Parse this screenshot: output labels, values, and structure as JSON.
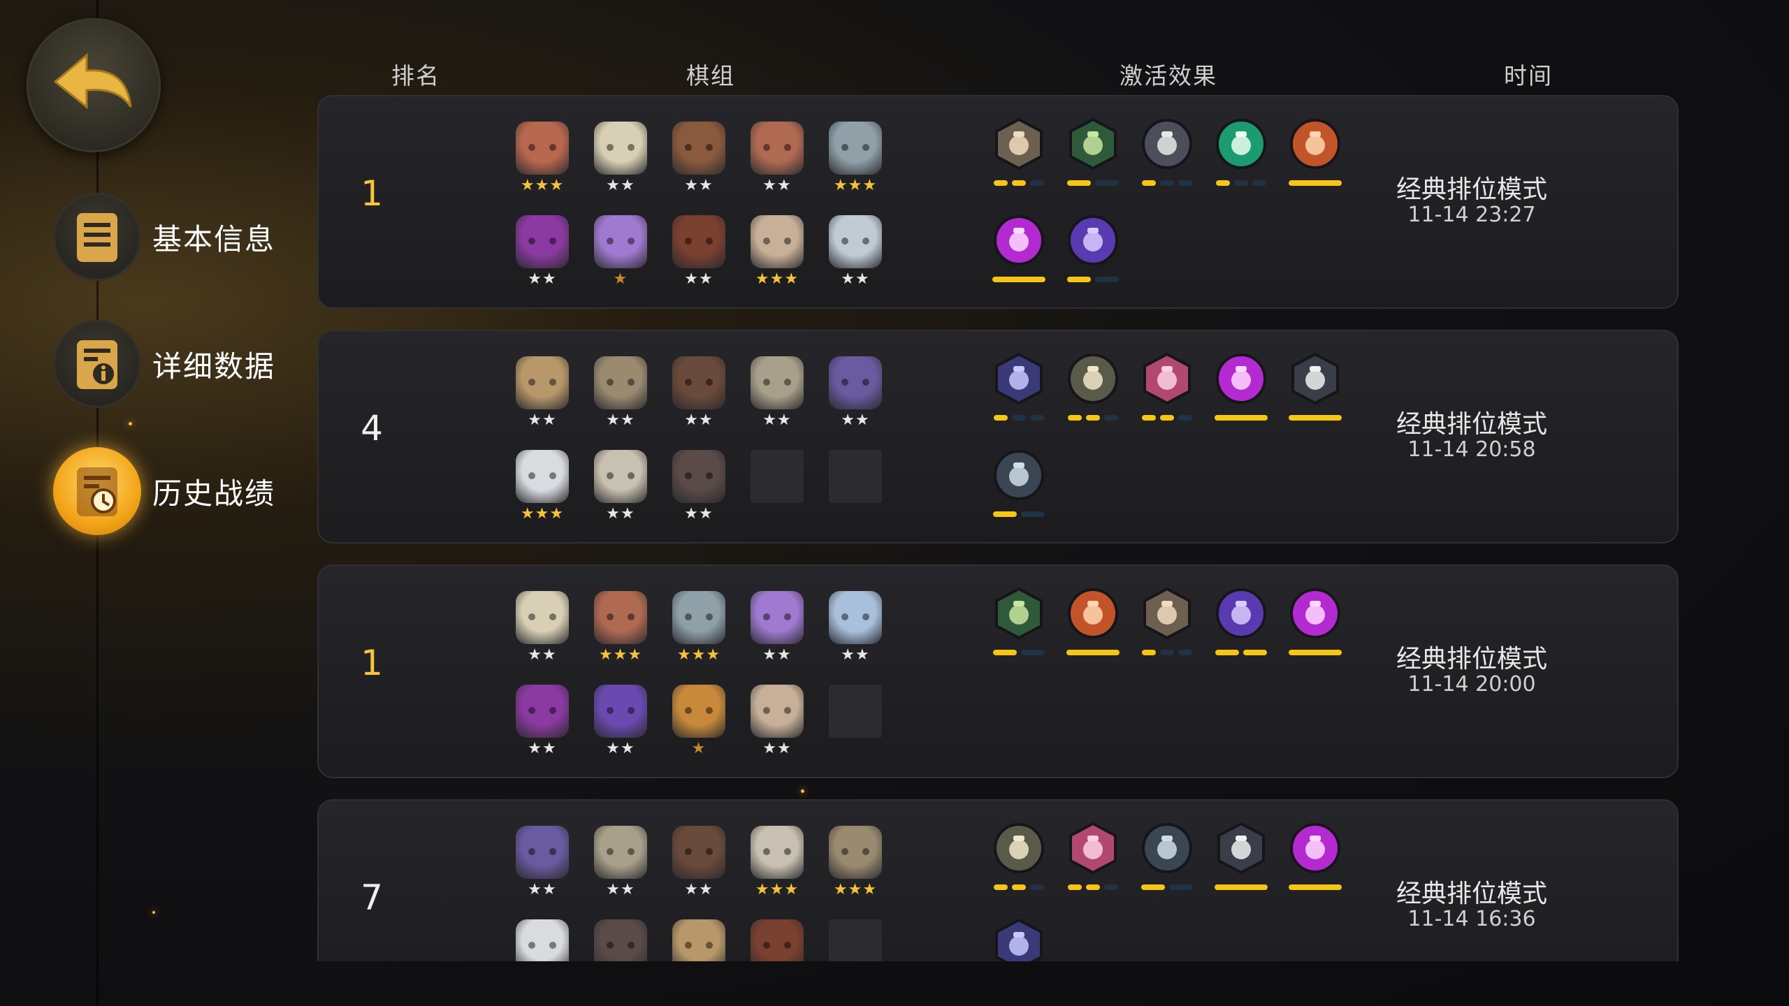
{
  "sidebar": {
    "back_icon": "back-arrow-icon",
    "items": [
      {
        "label": "基本信息",
        "icon": "document-icon",
        "active": false
      },
      {
        "label": "详细数据",
        "icon": "info-document-icon",
        "active": false
      },
      {
        "label": "历史战绩",
        "icon": "history-clock-icon",
        "active": true
      }
    ]
  },
  "table": {
    "headers": {
      "rank": "排名",
      "lineup": "棋组",
      "synergy": "激活效果",
      "time": "时间"
    },
    "rows": [
      {
        "rank": "1",
        "rank_color": "gold",
        "mode": "经典排位模式",
        "time": "11-14 23:27",
        "heroes": [
          {
            "icon": "owl-mask-hero-icon",
            "color": "#b8684e",
            "stars": "★★★",
            "tier": 3
          },
          {
            "icon": "white-hood-hero-icon",
            "color": "#d8cfb4",
            "stars": "★★",
            "tier": 2
          },
          {
            "icon": "boar-hero-icon",
            "color": "#8a5a3c",
            "stars": "★★",
            "tier": 2
          },
          {
            "icon": "goggles-dwarf-hero-icon",
            "color": "#b06a52",
            "stars": "★★",
            "tier": 2
          },
          {
            "icon": "ogre-hero-icon",
            "color": "#8fa0a8",
            "stars": "★★★",
            "tier": 3
          },
          {
            "icon": "horned-demon-hero-icon",
            "color": "#8a3aa0",
            "stars": "★★",
            "tier": 2
          },
          {
            "icon": "purple-hood-hero-icon",
            "color": "#a07ad0",
            "stars": "★",
            "tier": 1
          },
          {
            "icon": "red-cap-dwarf-hero-icon",
            "color": "#7a4030",
            "stars": "★★",
            "tier": 2
          },
          {
            "icon": "troll-hero-icon",
            "color": "#c8b098",
            "stars": "★★★",
            "tier": 3
          },
          {
            "icon": "white-haired-hero-icon",
            "color": "#c0ccd4",
            "stars": "★★",
            "tier": 2
          }
        ],
        "traits": [
          {
            "icon": "axe-warrior-trait-icon",
            "bg": "#6e6050",
            "fg": "#f2dcc0",
            "shape": "hex",
            "bar": [
              1,
              1,
              0
            ]
          },
          {
            "icon": "bow-hunter-trait-icon",
            "bg": "#2f5a3a",
            "fg": "#c8e6a0",
            "shape": "hex",
            "bar": [
              1,
              0
            ]
          },
          {
            "icon": "knight-helm-trait-icon",
            "bg": "#4a4f5a",
            "fg": "#e8e8e8",
            "shape": "circle",
            "bar": [
              1,
              0,
              0
            ]
          },
          {
            "icon": "beast-paw-trait-icon",
            "bg": "#1c9a70",
            "fg": "#e8fff0",
            "shape": "circle",
            "bar": [
              1,
              0,
              0
            ]
          },
          {
            "icon": "orc-trait-icon",
            "bg": "#c2542a",
            "fg": "#ffd6b0",
            "shape": "circle",
            "bar": [
              1
            ]
          },
          {
            "icon": "demon-trait-icon",
            "bg": "#b22ad0",
            "fg": "#ffd8ff",
            "shape": "circle",
            "bar": [
              1
            ]
          },
          {
            "icon": "fish-naga-trait-icon",
            "bg": "#5a3ab0",
            "fg": "#d8ccff",
            "shape": "circle",
            "bar": [
              1,
              0
            ]
          }
        ]
      },
      {
        "rank": "4",
        "rank_color": "white",
        "mode": "经典排位模式",
        "time": "11-14 20:58",
        "heroes": [
          {
            "icon": "tree-ent-hero-icon",
            "color": "#b8986a",
            "stars": "★★",
            "tier": 2
          },
          {
            "icon": "horned-orc-hero-icon",
            "color": "#9a8a70",
            "stars": "★★",
            "tier": 2
          },
          {
            "icon": "bull-hat-hero-icon",
            "color": "#6a4a3a",
            "stars": "★★",
            "tier": 2
          },
          {
            "icon": "stone-golem-hero-icon",
            "color": "#a8a08a",
            "stars": "★★",
            "tier": 2
          },
          {
            "icon": "bat-demon-hero-icon",
            "color": "#6a5aa0",
            "stars": "★★",
            "tier": 2
          },
          {
            "icon": "sheep-horn-hero-icon",
            "color": "#d8dce0",
            "stars": "★★★",
            "tier": 3
          },
          {
            "icon": "silver-hair-hero-icon",
            "color": "#c8c0b0",
            "stars": "★★",
            "tier": 2
          },
          {
            "icon": "dark-hair-hero-icon",
            "color": "#5a4a48",
            "stars": "★★",
            "tier": 2
          },
          {
            "empty": true
          },
          {
            "empty": true
          }
        ],
        "traits": [
          {
            "icon": "spellbook-trait-icon",
            "bg": "#3a3a78",
            "fg": "#c8c8ff",
            "shape": "hex",
            "bar": [
              1,
              0,
              0
            ]
          },
          {
            "icon": "goblin-trait-icon",
            "bg": "#5a5a4a",
            "fg": "#f0e8c8",
            "shape": "circle",
            "bar": [
              1,
              1,
              0
            ]
          },
          {
            "icon": "knight-chess-trait-icon",
            "bg": "#b04870",
            "fg": "#ffd0e0",
            "shape": "hex",
            "bar": [
              1,
              1,
              0
            ]
          },
          {
            "icon": "demon-trait-icon",
            "bg": "#b22ad0",
            "fg": "#ffd8ff",
            "shape": "circle",
            "bar": [
              1
            ]
          },
          {
            "icon": "cross-trait-icon",
            "bg": "#3a3e48",
            "fg": "#f0f0f0",
            "shape": "hex",
            "bar": [
              1
            ]
          },
          {
            "icon": "swirl-trait-icon",
            "bg": "#3a4654",
            "fg": "#d0dce8",
            "shape": "circle",
            "bar": [
              1,
              0
            ]
          }
        ]
      },
      {
        "rank": "1",
        "rank_color": "gold",
        "mode": "经典排位模式",
        "time": "11-14 20:00",
        "heroes": [
          {
            "icon": "white-hood-hero-icon",
            "color": "#d8cfb4",
            "stars": "★★",
            "tier": 2
          },
          {
            "icon": "goggles-dwarf-hero-icon",
            "color": "#b06a52",
            "stars": "★★★",
            "tier": 3
          },
          {
            "icon": "ogre-hero-icon",
            "color": "#8fa0a8",
            "stars": "★★★",
            "tier": 3
          },
          {
            "icon": "purple-hood-hero-icon",
            "color": "#a07ad0",
            "stars": "★★",
            "tier": 2
          },
          {
            "icon": "ghost-hero-icon",
            "color": "#a8c0dc",
            "stars": "★★",
            "tier": 2
          },
          {
            "icon": "horned-demon-hero-icon",
            "color": "#8a3aa0",
            "stars": "★★",
            "tier": 2
          },
          {
            "icon": "purple-mage-hero-icon",
            "color": "#6a4ab0",
            "stars": "★★",
            "tier": 2
          },
          {
            "icon": "witch-hat-hero-icon",
            "color": "#c88a3a",
            "stars": "★",
            "tier": 1
          },
          {
            "icon": "troll-hero-icon",
            "color": "#c8b098",
            "stars": "★★",
            "tier": 2
          },
          {
            "empty": true
          }
        ],
        "traits": [
          {
            "icon": "bow-hunter-trait-icon",
            "bg": "#2f5a3a",
            "fg": "#c8e6a0",
            "shape": "hex",
            "bar": [
              1,
              0
            ]
          },
          {
            "icon": "orc-trait-icon",
            "bg": "#c2542a",
            "fg": "#ffd6b0",
            "shape": "circle",
            "bar": [
              1
            ]
          },
          {
            "icon": "axe-warrior-trait-icon",
            "bg": "#6e6050",
            "fg": "#f2dcc0",
            "shape": "hex",
            "bar": [
              1,
              0,
              0
            ]
          },
          {
            "icon": "fish-naga-trait-icon",
            "bg": "#5a3ab0",
            "fg": "#d8ccff",
            "shape": "circle",
            "bar": [
              1,
              1
            ]
          },
          {
            "icon": "demon-trait-icon",
            "bg": "#b22ad0",
            "fg": "#ffd8ff",
            "shape": "circle",
            "bar": [
              1
            ]
          }
        ]
      },
      {
        "rank": "7",
        "rank_color": "white",
        "mode": "经典排位模式",
        "time": "11-14 16:36",
        "heroes": [
          {
            "icon": "bat-demon-hero-icon",
            "color": "#6a5aa0",
            "stars": "★★",
            "tier": 2
          },
          {
            "icon": "stone-golem-hero-icon",
            "color": "#a8a08a",
            "stars": "★★",
            "tier": 2
          },
          {
            "icon": "bull-hat-hero-icon",
            "color": "#6a4a3a",
            "stars": "★★",
            "tier": 2
          },
          {
            "icon": "silver-hair-hero-icon",
            "color": "#c8c0b0",
            "stars": "★★★",
            "tier": 3
          },
          {
            "icon": "horned-orc-hero-icon",
            "color": "#9a8a70",
            "stars": "★★★",
            "tier": 3
          },
          {
            "icon": "sheep-horn-hero-icon",
            "color": "#d8dce0",
            "stars": "",
            "tier": 0
          },
          {
            "icon": "dark-hair-hero-icon",
            "color": "#5a4a48",
            "stars": "",
            "tier": 0
          },
          {
            "icon": "tree-ent-hero-icon",
            "color": "#b8986a",
            "stars": "",
            "tier": 0
          },
          {
            "icon": "red-cap-dwarf-hero-icon",
            "color": "#7a4030",
            "stars": "",
            "tier": 0
          },
          {
            "empty": true
          }
        ],
        "traits": [
          {
            "icon": "goblin-trait-icon",
            "bg": "#5a5a4a",
            "fg": "#f0e8c8",
            "shape": "circle",
            "bar": [
              1,
              1,
              0
            ]
          },
          {
            "icon": "knight-chess-trait-icon",
            "bg": "#b04870",
            "fg": "#ffd0e0",
            "shape": "hex",
            "bar": [
              1,
              1,
              0
            ]
          },
          {
            "icon": "swirl-trait-icon",
            "bg": "#3a4654",
            "fg": "#d0dce8",
            "shape": "circle",
            "bar": [
              1,
              0
            ]
          },
          {
            "icon": "cross-trait-icon",
            "bg": "#3a3e48",
            "fg": "#f0f0f0",
            "shape": "hex",
            "bar": [
              1
            ]
          },
          {
            "icon": "demon-trait-icon",
            "bg": "#b22ad0",
            "fg": "#ffd8ff",
            "shape": "circle",
            "bar": [
              1
            ]
          },
          {
            "icon": "spellbook-trait-icon",
            "bg": "#3a3a78",
            "fg": "#c8c8ff",
            "shape": "hex",
            "bar": []
          }
        ]
      }
    ]
  }
}
